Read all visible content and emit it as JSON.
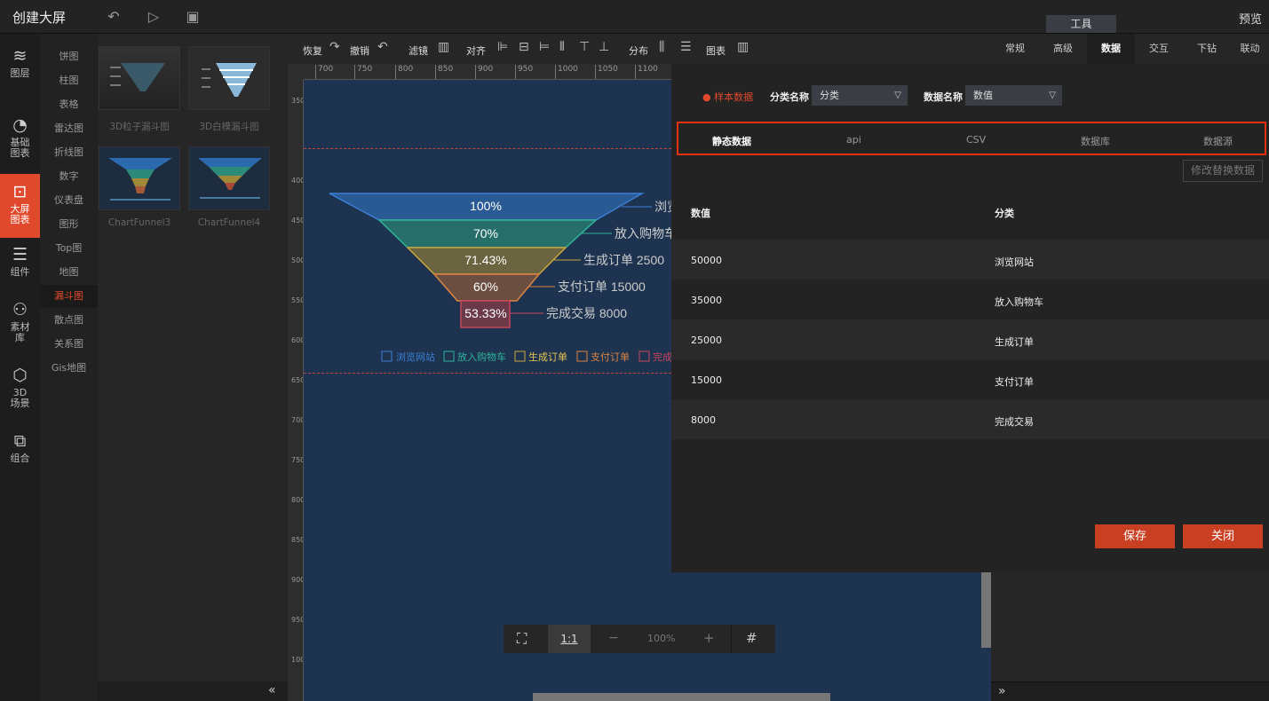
{
  "app": {
    "title": "创建大屏",
    "preview": "预览",
    "tools_tab": "工具"
  },
  "leftnav": [
    {
      "icon": "layers-icon",
      "label": "图层"
    },
    {
      "icon": "pie-chart-icon",
      "label": "基础图表"
    },
    {
      "icon": "bigscreen-chart-icon",
      "label": "大屏图表"
    },
    {
      "icon": "sliders-icon",
      "label": "组件"
    },
    {
      "icon": "material-icon",
      "label": "素材库"
    },
    {
      "icon": "cube-icon",
      "label": "3D场景"
    },
    {
      "icon": "group-icon",
      "label": "组合"
    }
  ],
  "categories": [
    "饼图",
    "柱图",
    "表格",
    "雷达图",
    "折线图",
    "数字",
    "仪表盘",
    "图形",
    "Top图",
    "地图",
    "漏斗图",
    "散点图",
    "关系图",
    "Gis地图"
  ],
  "thumbnails": [
    "3D粒子漏斗图",
    "3D白模漏斗图",
    "ChartFunnel3",
    "ChartFunnel4"
  ],
  "toolbar": {
    "redo": "恢复",
    "undo": "撤销",
    "filter": "滤镜",
    "align": "对齐",
    "distribute": "分布",
    "chart": "图表"
  },
  "panel_tabs": [
    "常规",
    "高级",
    "数据",
    "交互",
    "下钻",
    "联动"
  ],
  "ruler_h": [
    "700",
    "750",
    "800",
    "850",
    "900",
    "950",
    "1000",
    "1050",
    "1100"
  ],
  "ruler_v": [
    "350",
    "400",
    "450",
    "500",
    "550",
    "600",
    "650",
    "700",
    "750",
    "800",
    "850",
    "900",
    "950",
    "1000"
  ],
  "funnel": {
    "stages": [
      {
        "pct": "100%",
        "label": "浏览网站",
        "value": "50000",
        "color": "#3b7fd3"
      },
      {
        "pct": "70%",
        "label": "放入购物车",
        "value": "35000",
        "color": "#2fb39a"
      },
      {
        "pct": "71.43%",
        "label": "生成订单",
        "value": "25000",
        "color": "#c9a63c"
      },
      {
        "pct": "60%",
        "label": "支付订单",
        "value": "15000",
        "color": "#d98442"
      },
      {
        "pct": "53.33%",
        "label": "完成交易",
        "value": "8000",
        "color": "#c9455a"
      }
    ],
    "labels_shown": [
      "浏览",
      "放入购物车",
      "生成订单 2500",
      "支付订单 15000",
      "完成交易 8000"
    ],
    "legend": [
      "浏览网站",
      "放入购物车",
      "生成订单",
      "支付订单",
      "完成"
    ]
  },
  "zoom": {
    "fit": "1:1",
    "minus": "−",
    "level": "100%",
    "plus": "+"
  },
  "data_panel": {
    "sample": "● 样本数据",
    "cat_name_label": "分类名称",
    "cat_name_value": "分类",
    "data_name_label": "数据名称",
    "data_name_value": "数值",
    "sources": [
      "静态数据",
      "api",
      "CSV",
      "数据库",
      "数据源"
    ],
    "modify": "修改替换数据",
    "columns": [
      "数值",
      "分类"
    ],
    "rows": [
      [
        "50000",
        "浏览网站"
      ],
      [
        "35000",
        "放入购物车"
      ],
      [
        "25000",
        "生成订单"
      ],
      [
        "15000",
        "支付订单"
      ],
      [
        "8000",
        "完成交易"
      ]
    ],
    "save": "保存",
    "close": "关闭"
  }
}
